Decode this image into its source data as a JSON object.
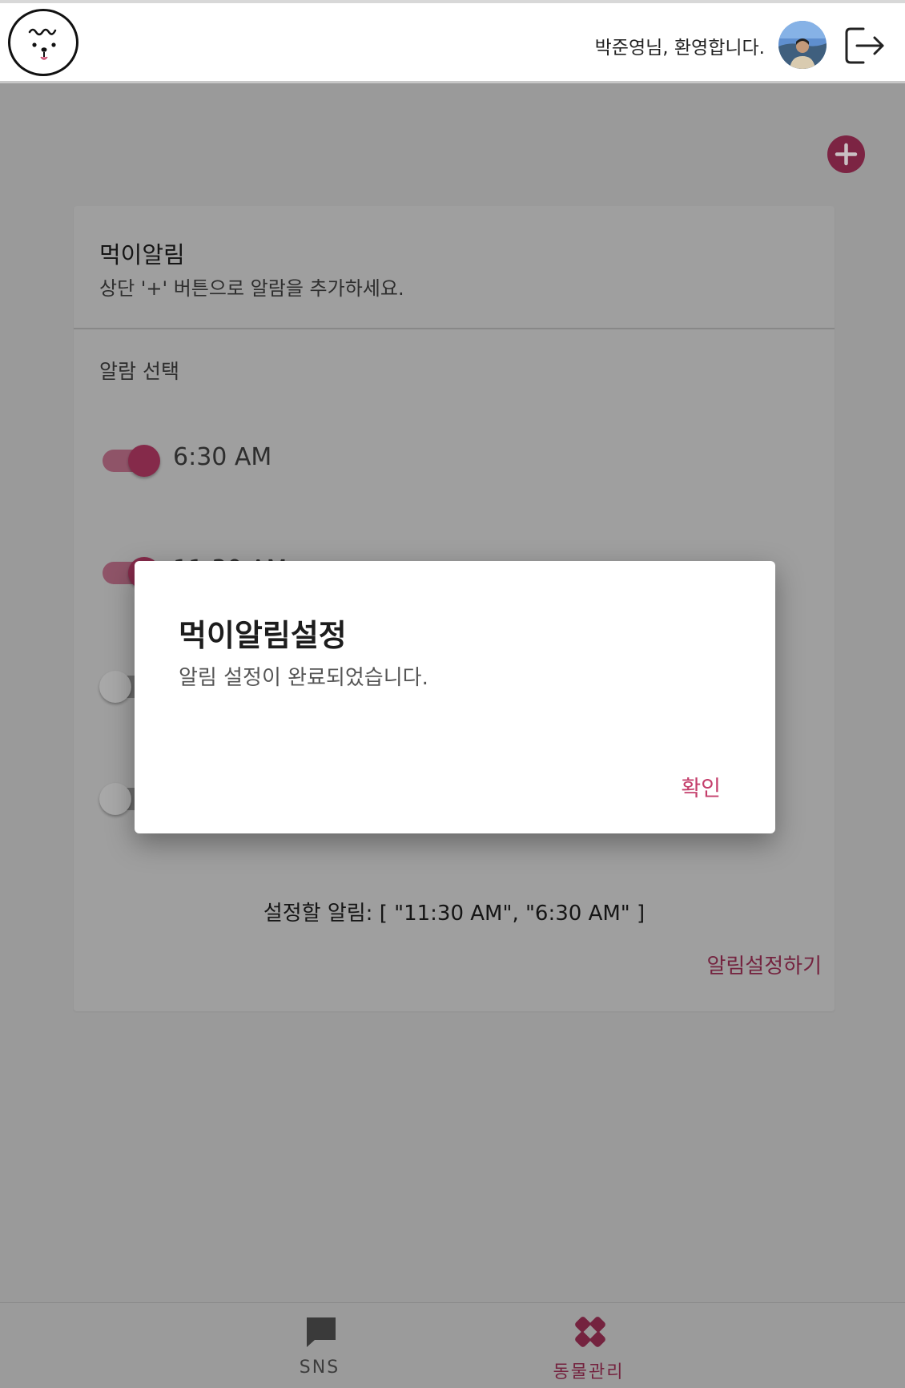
{
  "header": {
    "welcome_text": "박준영님, 환영합니다.",
    "logo_icon": "dog-face-icon",
    "logout_icon": "logout-icon"
  },
  "add_button": {
    "icon": "plus-icon",
    "color": "#7c2443"
  },
  "card": {
    "title": "먹이알림",
    "subtitle": "상단 '+' 버튼으로 알람을 추가하세요.",
    "select_label": "알람 선택",
    "alarms": [
      {
        "time": "6:30 AM",
        "enabled": true
      },
      {
        "time": "11:30 AM",
        "enabled": true
      },
      {
        "time": "",
        "enabled": false
      },
      {
        "time": "",
        "enabled": false
      }
    ],
    "pending_text": "설정할 알림: [ \"11:30 AM\", \"6:30 AM\" ]",
    "set_button": "알림설정하기"
  },
  "bottom_nav": {
    "items": [
      {
        "label": "SNS",
        "icon": "chat-bubble-icon",
        "active": false
      },
      {
        "label": "동물관리",
        "icon": "bandage-icon",
        "active": true
      }
    ]
  },
  "dialog": {
    "title": "먹이알림설정",
    "message": "알림 설정이 완료되었습니다.",
    "confirm": "확인"
  },
  "colors": {
    "accent": "#c43e6b",
    "accent_dark": "#74233f",
    "scrim_bg": "#9a9a9a"
  }
}
